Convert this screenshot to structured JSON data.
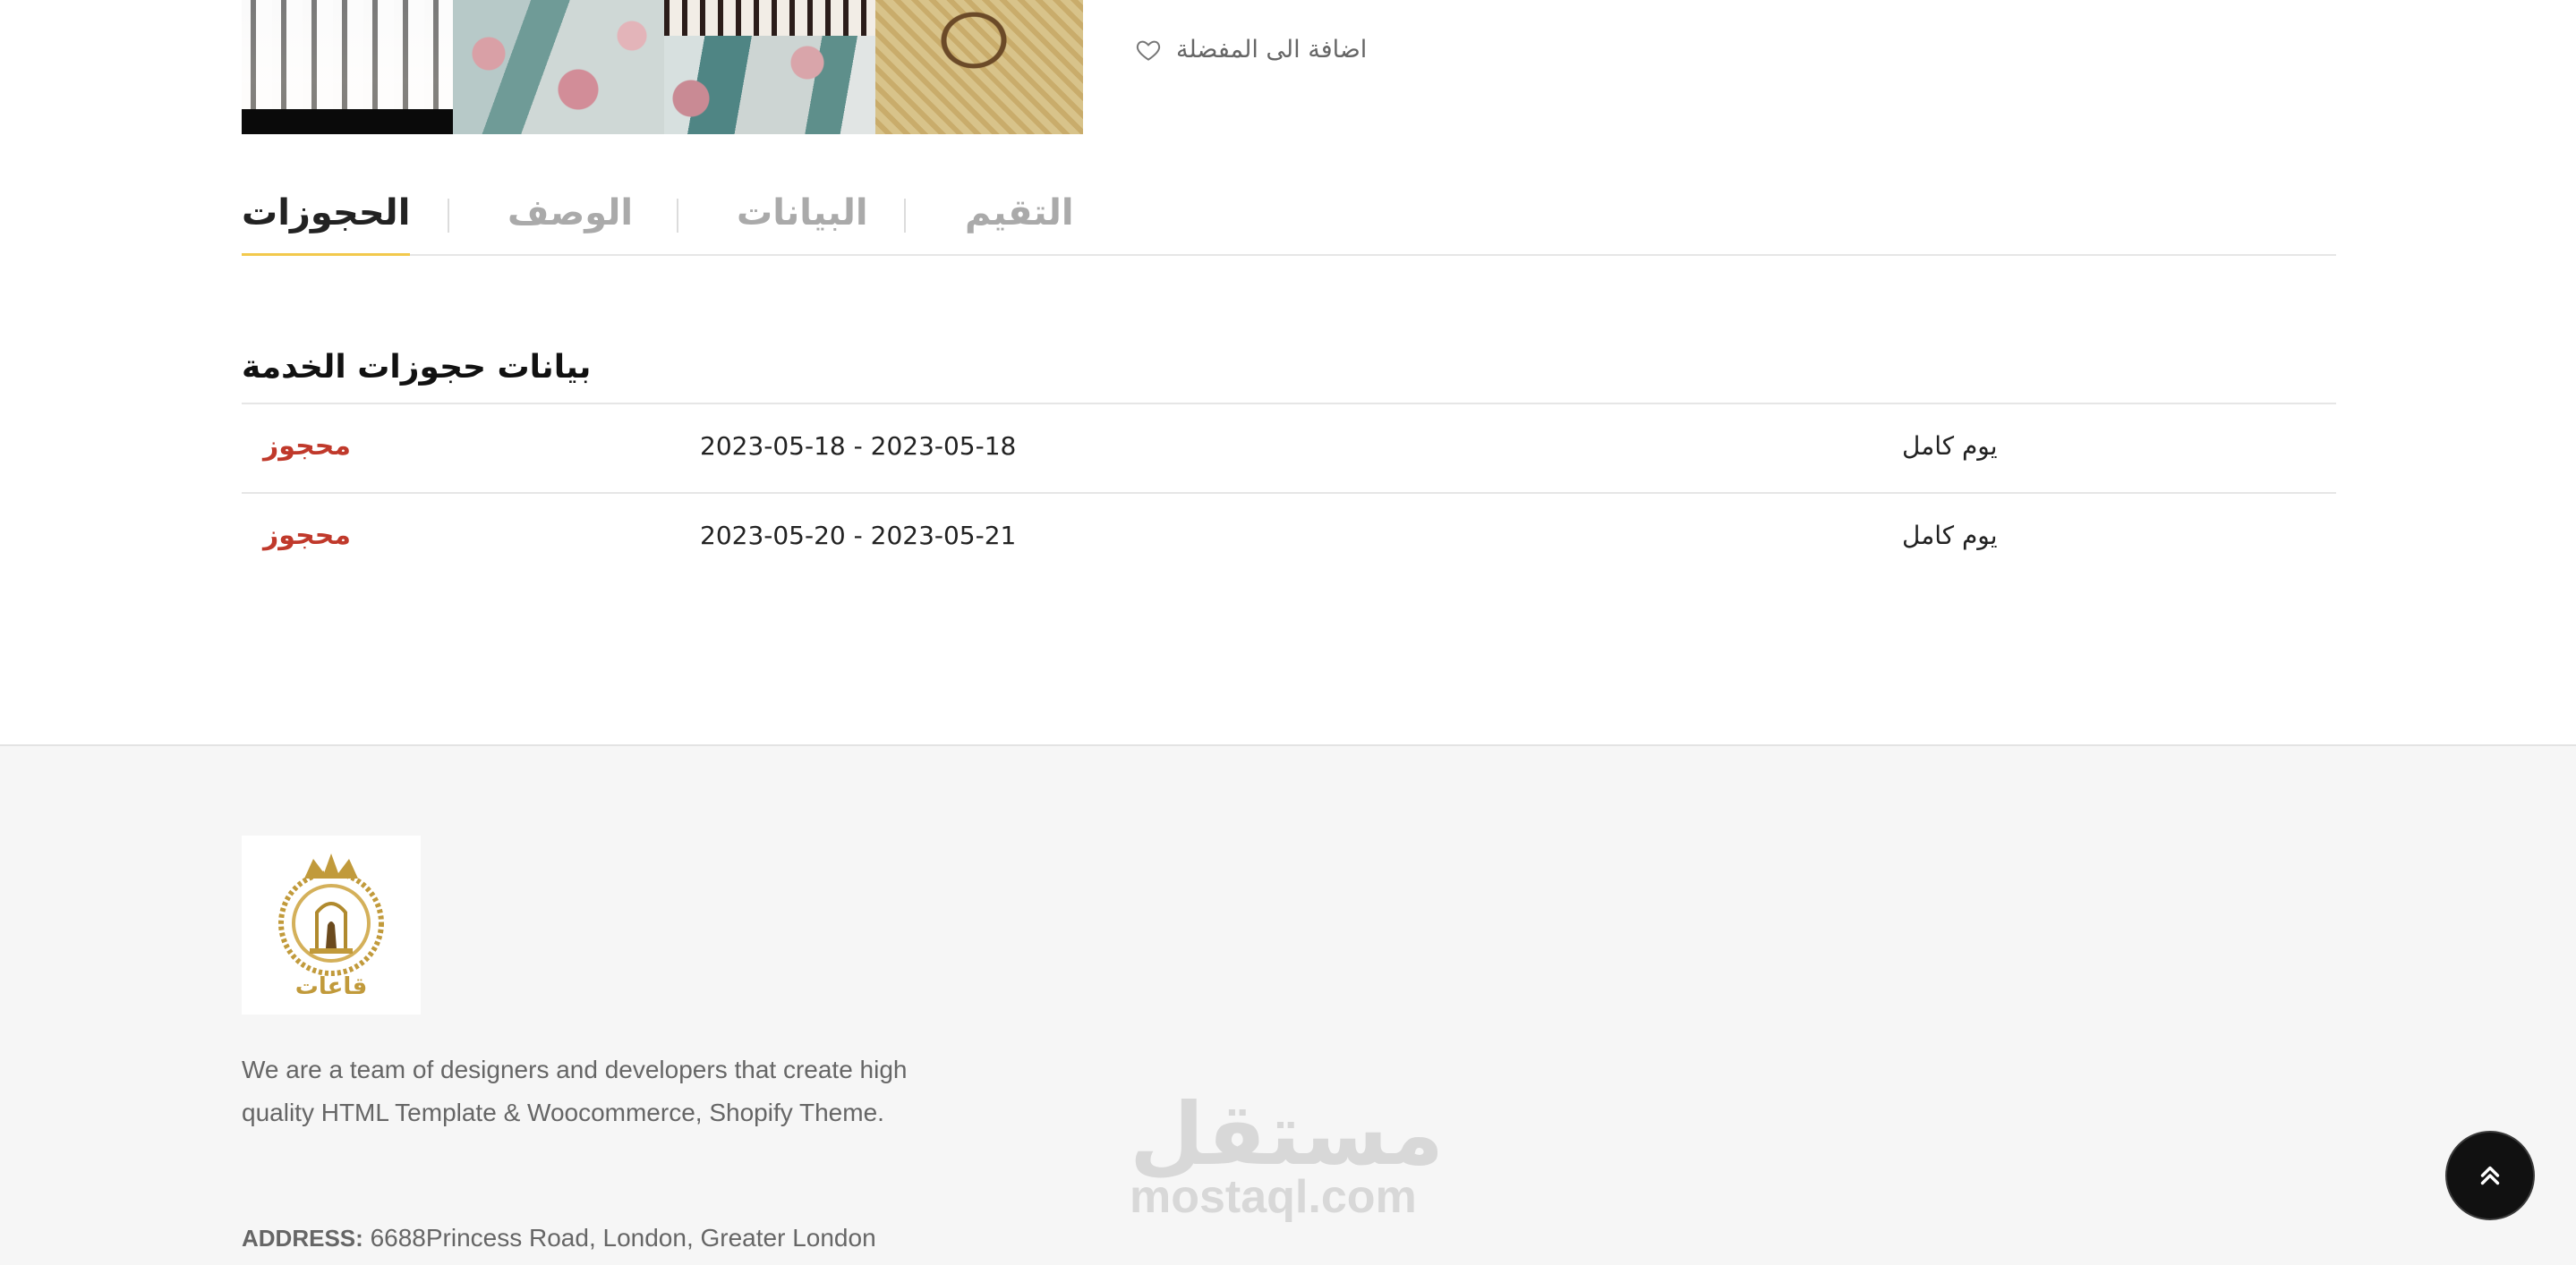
{
  "favorite": {
    "label": "اضافة الى المفضلة",
    "icon": "heart-icon"
  },
  "tabs": [
    {
      "label": "الحجوزات",
      "active": true
    },
    {
      "label": "الوصف",
      "active": false
    },
    {
      "label": "البيانات",
      "active": false
    },
    {
      "label": "التقيم",
      "active": false
    }
  ],
  "bookings": {
    "title": "بيانات حجوزات الخدمة",
    "rows": [
      {
        "status": "محجوز",
        "dates": "2023-05-18 - 2023-05-18",
        "type": "يوم كامل"
      },
      {
        "status": "محجوز",
        "dates": "2023-05-20 - 2023-05-21",
        "type": "يوم كامل"
      }
    ]
  },
  "footer": {
    "logo_text": "قاعات",
    "about": "We are a team of designers and developers that create high quality HTML Template & Woocommerce, Shopify Theme.",
    "address_label": "ADDRESS:",
    "address": " 6688Princess Road, London, Greater London"
  },
  "watermark": {
    "arabic": "مستقل",
    "latin": "mostaql.com"
  },
  "colors": {
    "accent_underline": "#f2c94c",
    "status_booked": "#c0392b",
    "logo_gold": "#c19a3b",
    "footer_bg": "#f6f6f6"
  }
}
